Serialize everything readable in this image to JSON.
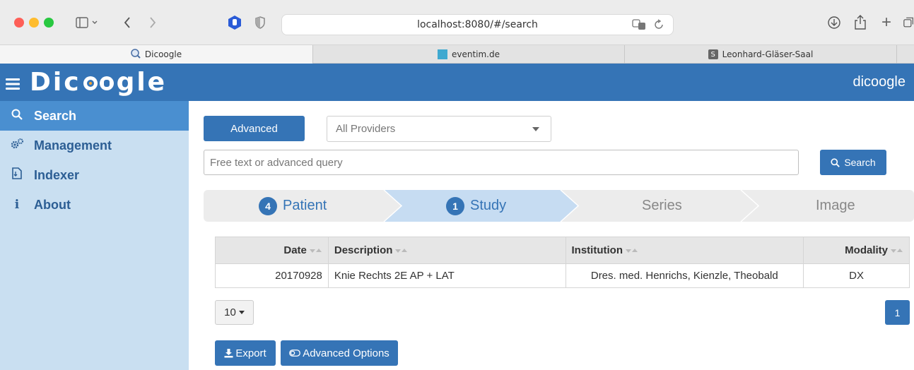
{
  "browser": {
    "url": "localhost:8080/#/search",
    "tabs": [
      {
        "label": "Dicoogle",
        "active": true
      },
      {
        "label": "eventim.de",
        "active": false
      },
      {
        "label": "Leonhard-Gläser-Saal",
        "favicon_letter": "S",
        "active": false
      }
    ]
  },
  "app": {
    "logo": "Dic●●gle",
    "user": "dicoogle",
    "brand_color": "#3574b6"
  },
  "sidebar": {
    "items": [
      {
        "label": "Search",
        "icon": "search-icon",
        "active": true
      },
      {
        "label": "Management",
        "icon": "gears-icon",
        "active": false
      },
      {
        "label": "Indexer",
        "icon": "file-icon",
        "active": false
      },
      {
        "label": "About",
        "icon": "info-icon",
        "active": false
      }
    ]
  },
  "search": {
    "advanced_label": "Advanced",
    "provider_selected": "All Providers",
    "query_placeholder": "Free text or advanced query",
    "search_label": "Search"
  },
  "steps": [
    {
      "count": "4",
      "label": "Patient"
    },
    {
      "count": "1",
      "label": "Study"
    },
    {
      "count": "",
      "label": "Series"
    },
    {
      "count": "",
      "label": "Image"
    }
  ],
  "table": {
    "headers": [
      "Date",
      "Description",
      "Institution",
      "Modality"
    ],
    "rows": [
      [
        "20170928",
        "Knie Rechts 2E AP + LAT",
        "Dres. med. Henrichs, Kienzle, Theobald",
        "DX"
      ]
    ]
  },
  "pagination": {
    "page_size": "10",
    "current_page": "1"
  },
  "actions": {
    "export_label": "Export",
    "advanced_options_label": "Advanced Options"
  }
}
